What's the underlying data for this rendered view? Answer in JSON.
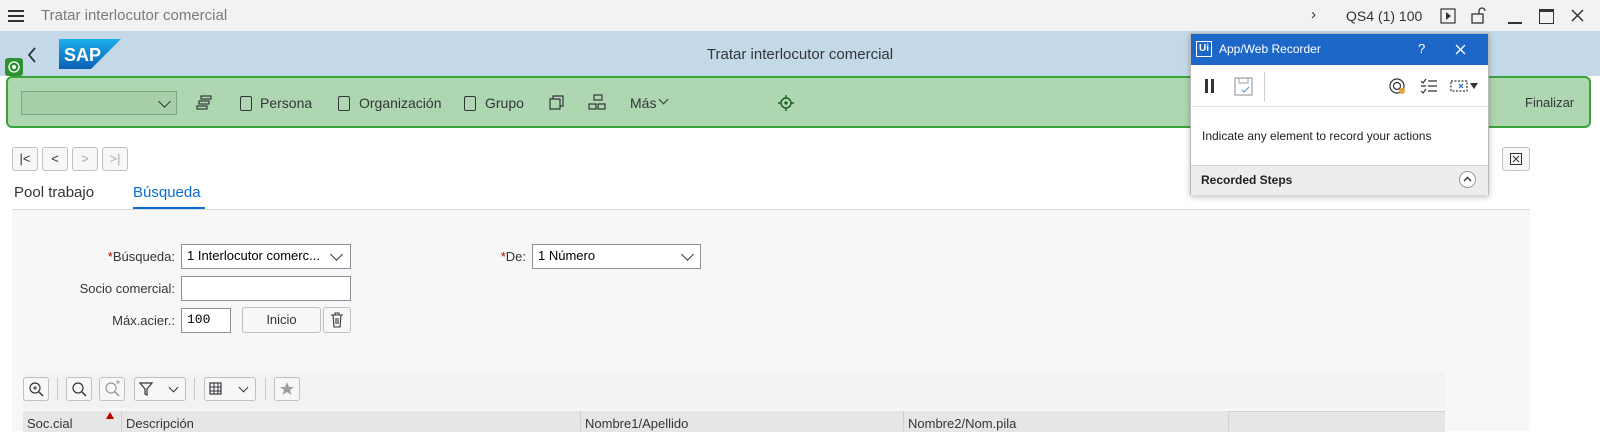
{
  "window": {
    "title": "Tratar interlocutor comercial",
    "system": "QS4 (1) 100"
  },
  "header": {
    "title": "Tratar interlocutor comercial",
    "logo_text": "SAP"
  },
  "toolbar": {
    "persona": "Persona",
    "organizacion": "Organización",
    "grupo": "Grupo",
    "mas": "Más",
    "finalizar": "Finalizar"
  },
  "tabs": [
    "Pool trabajo",
    "Búsqueda"
  ],
  "form": {
    "busqueda_label": "Búsqueda:",
    "busqueda_value": "1 Interlocutor comerc...",
    "de_label": "De:",
    "de_value": "1 Número",
    "socio_label": "Socio comercial:",
    "socio_value": "",
    "max_label": "Máx.acier.:",
    "max_value": "100",
    "inicio": "Inicio"
  },
  "table": {
    "columns": [
      "Soc.cial",
      "Descripción",
      "Nombre1/Apellido",
      "Nombre2/Nom.pila"
    ]
  },
  "recorder": {
    "title": "App/Web Recorder",
    "help": "?",
    "logo": "Ui",
    "message": "Indicate any element to record your actions",
    "steps": "Recorded Steps"
  },
  "colors": {
    "toolbar_bg": "#aed6b0",
    "toolbar_border": "#39a33c",
    "header_bg": "#c4d9e8",
    "accent": "#0a6ed1",
    "recorder_bar": "#1d67c9"
  }
}
